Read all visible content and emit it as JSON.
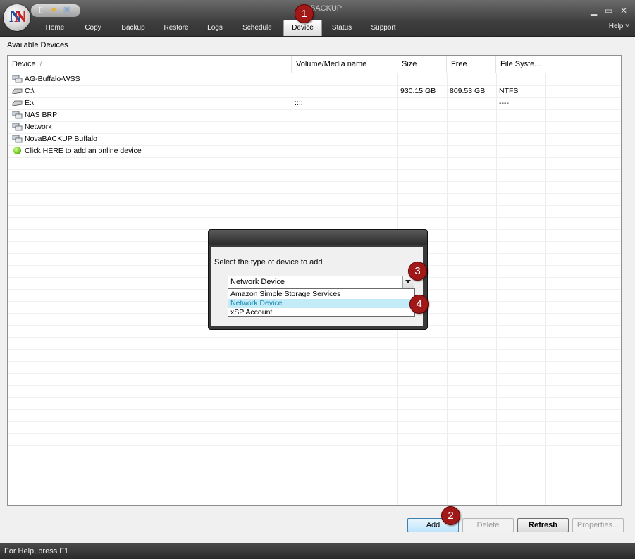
{
  "window": {
    "title": "BACKUP",
    "quick_access_icons": [
      "new-file-icon",
      "open-folder-icon",
      "save-disk-icon"
    ],
    "controls": [
      "minimize-icon",
      "maximize-icon",
      "close-icon"
    ]
  },
  "tabs": [
    {
      "label": "Home"
    },
    {
      "label": "Copy"
    },
    {
      "label": "Backup"
    },
    {
      "label": "Restore"
    },
    {
      "label": "Logs"
    },
    {
      "label": "Schedule"
    },
    {
      "label": "Device",
      "active": true
    },
    {
      "label": "Status"
    },
    {
      "label": "Support"
    }
  ],
  "help_label": "Help",
  "section_label": "Available Devices",
  "columns": [
    "Device",
    "Volume/Media name",
    "Size",
    "Free",
    "File Syste..."
  ],
  "sort_indicator": "/",
  "devices": [
    {
      "name": "AG-Buffalo-WSS",
      "icon": "network-computer-icon",
      "volume": "",
      "size": "",
      "free": "",
      "fs": ""
    },
    {
      "name": "C:\\",
      "icon": "hard-drive-icon",
      "volume": "",
      "size": "930.15 GB",
      "free": "809.53 GB",
      "fs": "NTFS"
    },
    {
      "name": "E:\\",
      "icon": "hard-drive-icon",
      "volume": "::::",
      "size": "",
      "free": "",
      "fs": "----"
    },
    {
      "name": "NAS BRP",
      "icon": "network-computer-icon",
      "volume": "",
      "size": "",
      "free": "",
      "fs": ""
    },
    {
      "name": "Network",
      "icon": "network-computer-icon",
      "volume": "",
      "size": "",
      "free": "",
      "fs": ""
    },
    {
      "name": "NovaBACKUP Buffalo",
      "icon": "network-computer-icon",
      "volume": "",
      "size": "",
      "free": "",
      "fs": ""
    },
    {
      "name": "Click HERE to add an online device",
      "icon": "online-device-icon",
      "volume": "",
      "size": "",
      "free": "",
      "fs": ""
    }
  ],
  "dialog": {
    "prompt": "Select the type of device to add",
    "selected": "Network Device",
    "options": [
      "Amazon Simple Storage Services",
      "Network Device",
      "xSP Account"
    ],
    "highlighted": "Network Device"
  },
  "buttons": {
    "add": "Add",
    "delete": "Delete",
    "refresh": "Refresh",
    "properties": "Properties..."
  },
  "callouts": [
    "1",
    "2",
    "3",
    "4"
  ],
  "status_text": "For Help, press F1",
  "colors": {
    "accent_callout": "#a01818",
    "highlight": "#c4ecf8",
    "online_device": "#6ac41c"
  }
}
